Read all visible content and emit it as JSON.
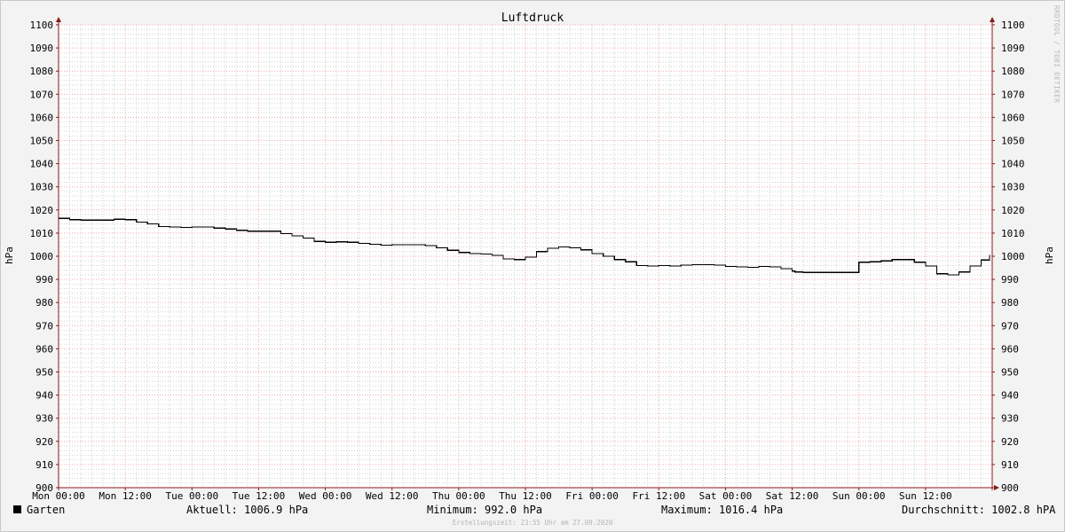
{
  "chart_data": {
    "type": "line",
    "title": "Luftdruck",
    "ylabel": "hPa",
    "ylim": [
      900,
      1100
    ],
    "yticks": [
      900,
      910,
      920,
      930,
      940,
      950,
      960,
      970,
      980,
      990,
      1000,
      1010,
      1020,
      1030,
      1040,
      1050,
      1060,
      1070,
      1080,
      1090,
      1100
    ],
    "xticks": [
      "Mon 00:00",
      "Mon 12:00",
      "Tue 00:00",
      "Tue 12:00",
      "Wed 00:00",
      "Wed 12:00",
      "Thu 00:00",
      "Thu 12:00",
      "Fri 00:00",
      "Fri 12:00",
      "Sat 00:00",
      "Sat 12:00",
      "Sun 00:00",
      "Sun 12:00"
    ],
    "grid": true,
    "series": [
      {
        "name": "Garten",
        "color": "#000000",
        "x_hours": [
          0,
          2,
          4,
          6,
          8,
          10,
          12,
          14,
          16,
          18,
          20,
          22,
          24,
          26,
          28,
          30,
          32,
          34,
          36,
          38,
          40,
          42,
          44,
          46,
          48,
          50,
          52,
          54,
          56,
          58,
          60,
          62,
          64,
          66,
          68,
          70,
          72,
          74,
          76,
          78,
          80,
          82,
          84,
          86,
          88,
          90,
          92,
          94,
          96,
          98,
          100,
          102,
          104,
          106,
          108,
          110,
          112,
          114,
          116,
          118,
          120,
          122,
          124,
          126,
          128,
          130,
          132,
          132.5,
          134,
          136,
          138,
          140,
          142,
          144,
          146,
          148,
          150,
          152,
          154,
          156,
          158,
          160,
          162,
          164,
          166,
          167.5
        ],
        "values": [
          1016.4,
          1015.8,
          1015.6,
          1015.6,
          1015.6,
          1016.0,
          1015.8,
          1014.8,
          1014.0,
          1012.8,
          1012.6,
          1012.4,
          1012.6,
          1012.6,
          1012.2,
          1011.8,
          1011.2,
          1010.8,
          1010.8,
          1010.8,
          1009.8,
          1008.8,
          1007.8,
          1006.4,
          1006.0,
          1006.2,
          1006.0,
          1005.6,
          1005.2,
          1004.8,
          1005.0,
          1005.0,
          1005.0,
          1004.6,
          1003.6,
          1002.6,
          1001.6,
          1001.2,
          1001.0,
          1000.4,
          998.8,
          998.6,
          999.6,
          1002.0,
          1003.4,
          1004.0,
          1003.6,
          1002.8,
          1001.2,
          1000.0,
          998.6,
          997.6,
          996.0,
          995.8,
          996.0,
          995.8,
          996.2,
          996.4,
          996.4,
          996.2,
          995.6,
          995.4,
          995.2,
          995.6,
          995.4,
          994.6,
          993.6,
          993.2,
          993.0,
          993.0,
          993.0,
          993.0,
          993.0,
          997.4,
          997.6,
          998.0,
          998.6,
          998.6,
          997.4,
          995.8,
          992.4,
          992.0,
          993.2,
          995.8,
          998.4,
          1000.6,
          1002.2,
          1003.0,
          1003.6,
          1004.4,
          1005.2,
          1006.0,
          1006.9
        ]
      }
    ]
  },
  "legend": {
    "series_label": "Garten",
    "current": "Aktuell: 1006.9 hPa",
    "minimum": "Minimum: 992.0 hPa",
    "maximum": "Maximum: 1016.4 hPa",
    "average": "Durchschnitt: 1002.8 hPA"
  },
  "footer": "Erstellungszeit: 23:55 Uhr am 27.09.2020",
  "watermark": "RRDTOOL / TOBI OETIKER",
  "colors": {
    "background": "#f3f3f3",
    "minor_grid": "#d2d2d2",
    "major_grid": "#f0a6a6",
    "axis": "#8b1a1a",
    "line": "#000000"
  }
}
